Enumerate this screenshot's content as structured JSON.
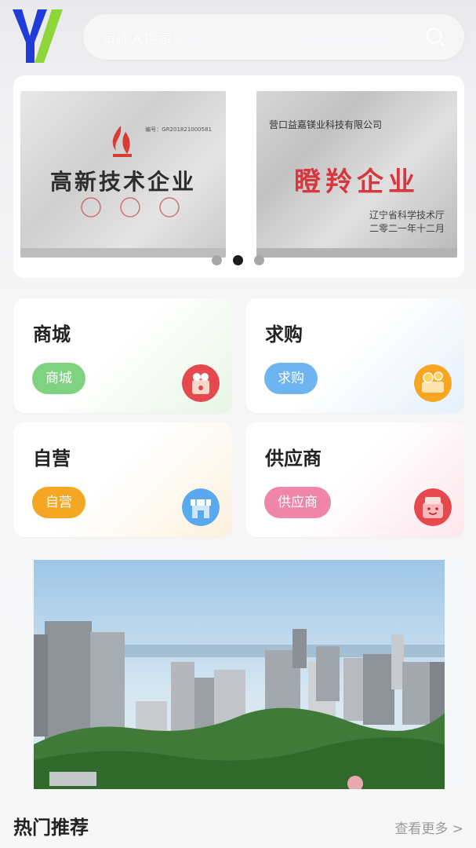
{
  "search": {
    "placeholder": "请输入搜索词"
  },
  "banner": {
    "cert_left": {
      "title": "高新技术企业",
      "number": "编号：GR201821000581"
    },
    "cert_right": {
      "company": "营口益嘉镁业科技有限公司",
      "title": "瞪羚企业",
      "issuer_line1": "辽宁省科学技术厅",
      "issuer_line2": "二零二一年十二月"
    },
    "page_count": 3,
    "active_index": 1
  },
  "categories": [
    {
      "title": "商城",
      "button": "商城",
      "color": "#7fd27f",
      "icon": "red-envelope-icon"
    },
    {
      "title": "求购",
      "button": "求购",
      "color": "#6db4f0",
      "icon": "coin-cart-icon"
    },
    {
      "title": "自营",
      "button": "自营",
      "color": "#f5a623",
      "icon": "shop-store-icon"
    },
    {
      "title": "供应商",
      "button": "供应商",
      "color": "#ef86a8",
      "icon": "smiling-gift-icon"
    }
  ],
  "hot": {
    "title": "热门推荐",
    "more": "查看更多 >"
  },
  "colors": {
    "logo_blue": "#1f3bd8",
    "logo_green": "#8fd63a"
  }
}
